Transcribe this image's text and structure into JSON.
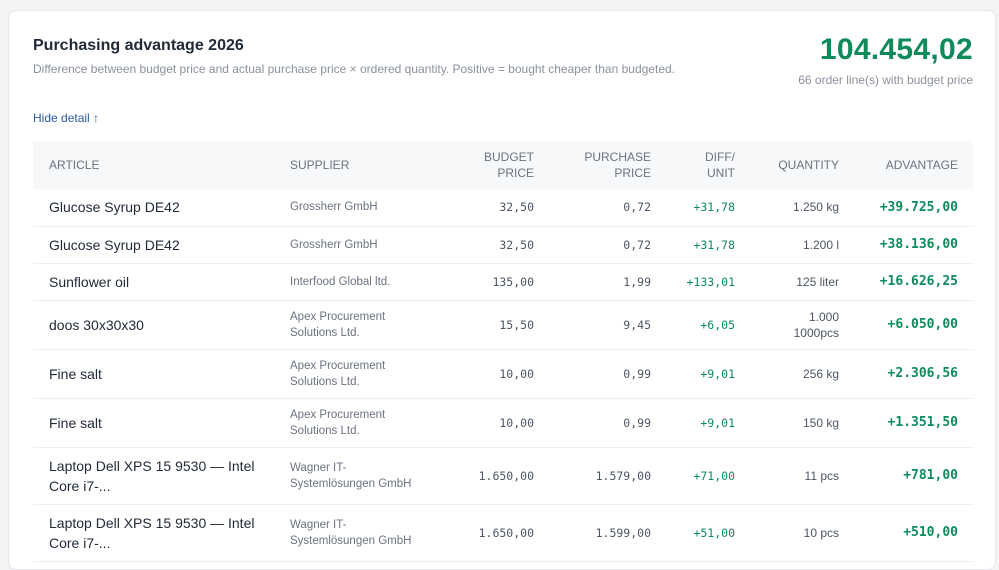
{
  "header": {
    "title": "Purchasing advantage 2026",
    "subtitle": "Difference between budget price and actual purchase price × ordered quantity. Positive = bought cheaper than budgeted.",
    "total": "104.454,02",
    "total_caption": "66 order line(s) with budget price",
    "toggle_label": "Hide detail ↑"
  },
  "table": {
    "columns": {
      "article": "ARTICLE",
      "supplier": "SUPPLIER",
      "budget_1": "BUDGET",
      "budget_2": "PRICE",
      "purchase_1": "PURCHASE",
      "purchase_2": "PRICE",
      "diff_1": "DIFF/",
      "diff_2": "UNIT",
      "quantity": "QUANTITY",
      "advantage": "ADVANTAGE"
    },
    "rows": [
      {
        "article": "Glucose Syrup DE42",
        "supplier": "Grossherr GmbH",
        "budget": "32,50",
        "purchase": "0,72",
        "diff": "+31,78",
        "qty": "1.250 kg",
        "adv": "+39.725,00"
      },
      {
        "article": "Glucose Syrup DE42",
        "supplier": "Grossherr GmbH",
        "budget": "32,50",
        "purchase": "0,72",
        "diff": "+31,78",
        "qty": "1.200 l",
        "adv": "+38.136,00"
      },
      {
        "article": "Sunflower oil",
        "supplier": "Interfood Global ltd.",
        "budget": "135,00",
        "purchase": "1,99",
        "diff": "+133,01",
        "qty": "125 liter",
        "adv": "+16.626,25"
      },
      {
        "article": "doos 30x30x30",
        "supplier": "Apex Procurement Solutions Ltd.",
        "budget": "15,50",
        "purchase": "9,45",
        "diff": "+6,05",
        "qty": "1.000 1000pcs",
        "adv": "+6.050,00"
      },
      {
        "article": "Fine salt",
        "supplier": "Apex Procurement Solutions Ltd.",
        "budget": "10,00",
        "purchase": "0,99",
        "diff": "+9,01",
        "qty": "256 kg",
        "adv": "+2.306,56"
      },
      {
        "article": "Fine salt",
        "supplier": "Apex Procurement Solutions Ltd.",
        "budget": "10,00",
        "purchase": "0,99",
        "diff": "+9,01",
        "qty": "150 kg",
        "adv": "+1.351,50"
      },
      {
        "article": "Laptop Dell XPS 15 9530 — Intel Core i7-...",
        "supplier": "Wagner IT-Systemlösungen GmbH",
        "budget": "1.650,00",
        "purchase": "1.579,00",
        "diff": "+71,00",
        "qty": "11 pcs",
        "adv": "+781,00"
      },
      {
        "article": "Laptop Dell XPS 15 9530 — Intel Core i7-...",
        "supplier": "Wagner IT-Systemlösungen GmbH",
        "budget": "1.650,00",
        "purchase": "1.599,00",
        "diff": "+51,00",
        "qty": "10 pcs",
        "adv": "+510,00"
      }
    ]
  },
  "colors": {
    "accent_green": "#0e8a5b",
    "link_blue": "#2c5aa0"
  }
}
